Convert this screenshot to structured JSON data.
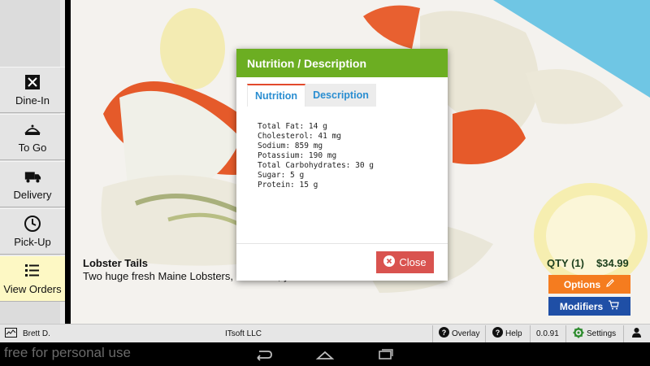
{
  "sidebar": {
    "items": [
      {
        "label": "Dine-In",
        "icon": "dine-in-icon"
      },
      {
        "label": "To Go",
        "icon": "to-go-icon"
      },
      {
        "label": "Delivery",
        "icon": "delivery-icon"
      },
      {
        "label": "Pick-Up",
        "icon": "clock-icon"
      },
      {
        "label": "View Orders",
        "icon": "list-icon"
      }
    ]
  },
  "item": {
    "name": "Lobster Tails",
    "description": "Two huge fresh Maine Lobsters, … sauce, you'll want more!",
    "qty": "QTY (1)",
    "price": "$34.99",
    "options_label": "Options",
    "modifiers_label": "Modifiers"
  },
  "modal": {
    "title": "Nutrition / Description",
    "tabs": [
      "Nutrition",
      "Description"
    ],
    "nutrition": [
      "Total Fat: 14 g",
      "Cholesterol: 41 mg",
      "Sodium: 859 mg",
      "Potassium: 190 mg",
      "Total Carbohydrates: 30 g",
      "Sugar: 5 g",
      "Protein: 15 g"
    ],
    "close_label": "Close"
  },
  "statusbar": {
    "user": "Brett D.",
    "company": "ITsoft LLC",
    "overlay": "Overlay",
    "help": "Help",
    "version": "0.0.91",
    "settings": "Settings"
  },
  "watermark": "free for personal use",
  "colors": {
    "header_green": "#6cae22",
    "options_orange": "#f57c1f",
    "modifiers_blue": "#1f4fa6",
    "close_red": "#d9534f",
    "tab_blue": "#2a8ed1",
    "active_yellow": "#fdf8c4"
  }
}
